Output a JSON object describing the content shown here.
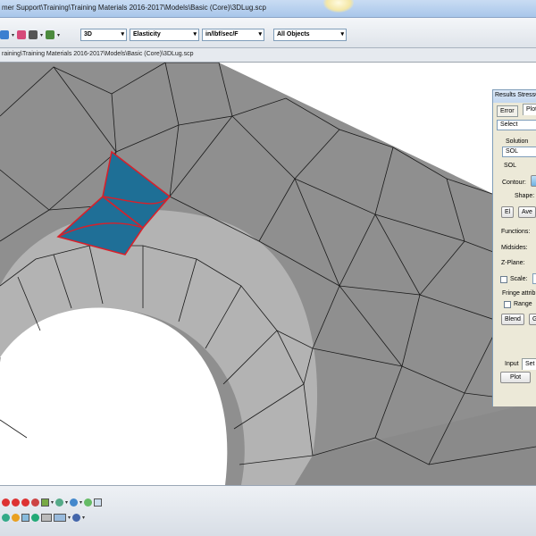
{
  "window": {
    "title": "mer Support\\Training\\Training Materials 2016-2017\\Models\\Basic (Core)\\3DLug.scp"
  },
  "toolbar": {
    "dimension": "3D",
    "analysis_type": "Elasticity",
    "units": "in/lbf/sec/F",
    "selection_filter": "All Objects"
  },
  "path_bar": {
    "text": "raining\\Training Materials 2016-2017\\Models\\Basic (Core)\\3DLug.scp"
  },
  "results_panel": {
    "title": "Results StressCh",
    "tabs": [
      "Error",
      "Plot"
    ],
    "select": "Select",
    "solution_label": "Solution",
    "solution_value": "SOL",
    "solution_text": "SOL",
    "contour_label": "Contour:",
    "shape_label": "Shape:",
    "el_button": "El",
    "ave_button": "Ave",
    "functions_label": "Functions:",
    "midsides_label": "Midsides:",
    "zplane_label": "Z-Plane:",
    "scale_label": "Scale:",
    "fringe_label": "Fringe attrib",
    "range_label": "Range",
    "blend_button": "Blend",
    "g_button": "G",
    "bottom_tabs": [
      "Input",
      "Set"
    ],
    "plot_button": "Plot"
  },
  "colors": {
    "highlight_element": "#1e6f96",
    "highlight_edge": "#d8202a",
    "mesh_face": "#8c8c8c",
    "hole_face": "#b0b0b0"
  }
}
